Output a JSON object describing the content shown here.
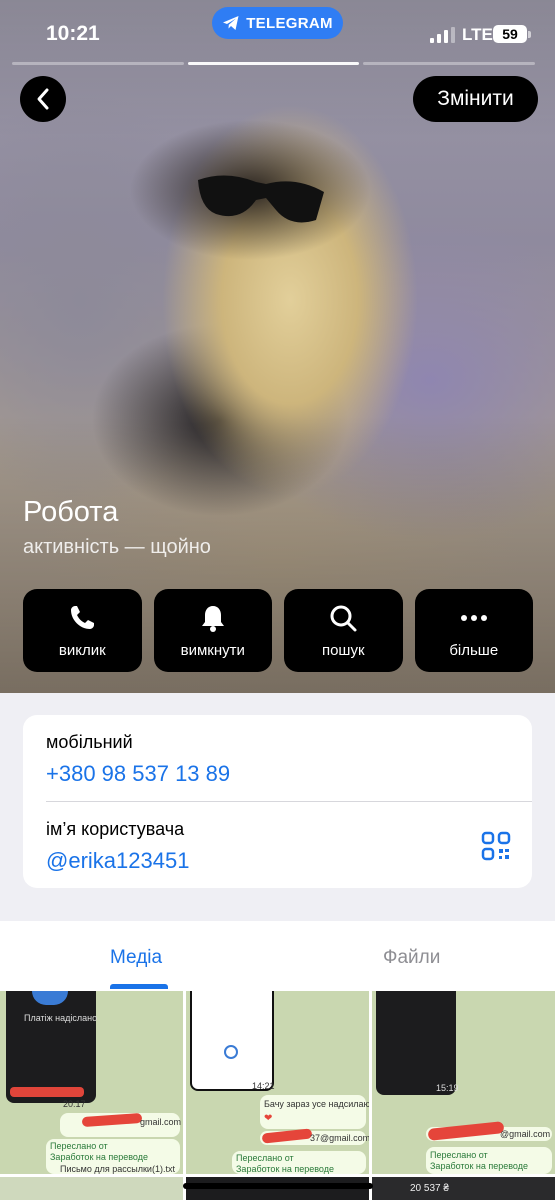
{
  "status_bar": {
    "time": "10:21",
    "app_pill": "TELEGRAM",
    "network": "LTE",
    "battery": "59"
  },
  "header": {
    "back_icon": "chevron-left-icon",
    "edit_label": "Змінити"
  },
  "profile": {
    "name": "Робота",
    "status": "активність — щойно"
  },
  "actions": [
    {
      "icon": "phone-icon",
      "label": "виклик"
    },
    {
      "icon": "bell-icon",
      "label": "вимкнути"
    },
    {
      "icon": "search-icon",
      "label": "пошук"
    },
    {
      "icon": "more-icon",
      "label": "більше"
    }
  ],
  "info": {
    "mobile_label": "мобільний",
    "mobile_value": "+380 98 537 13 89",
    "username_label": "ім’я користувача",
    "username_value": "@erika123451"
  },
  "media_tabs": {
    "media": "Медіа",
    "files": "Файли"
  },
  "thumbnails": [
    {
      "lines": [
        "Платіж надіслано",
        "20:17",
        "gmail.com",
        "Переслано от",
        "Заработок на переводе",
        "Письмо для рассылки(1).txt"
      ]
    },
    {
      "lines": [
        "14:21",
        "Бачу зараз усе надсилаю",
        "37@gmail.com",
        "Переслано от",
        "Заработок на переводе"
      ]
    },
    {
      "lines": [
        "15:19",
        "@gmail.com",
        "Переслано от",
        "Заработок на переводе",
        "20 537 ₴"
      ]
    }
  ],
  "colors": {
    "accent": "#1a73e8",
    "telegram_pill": "#2f7df4"
  }
}
